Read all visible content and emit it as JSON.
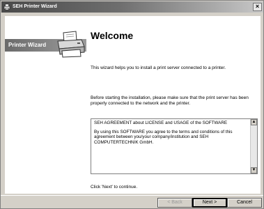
{
  "window": {
    "title": "SEH Printer Wizard",
    "close_label": "×"
  },
  "sidebar": {
    "banner_label": "Printer Wizard"
  },
  "main": {
    "title": "Welcome",
    "intro": "This wizard helps you to install a print server connected to a printer.",
    "before_install": "Before starting the installation, please make sure that the print server has been properly connected to the network and the printer.",
    "license": {
      "heading": "SEH AGREEMENT about LICENSE and USAGE of the SOFTWARE",
      "body": "By using this SOFTWARE you agree to the terms and conditions of this agreement between you/your company/institution and SEH COMPUTERTECHNIK GmbH.",
      "scroll_up_glyph": "▲",
      "scroll_down_glyph": "▼"
    },
    "continue_hint": "Click 'Next' to continue."
  },
  "buttons": {
    "back_label": "< Back",
    "next_label": "Next >",
    "cancel_label": "Cancel"
  }
}
